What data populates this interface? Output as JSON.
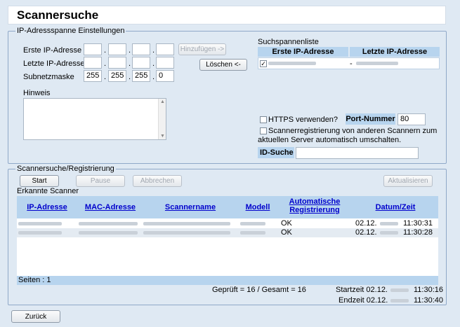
{
  "title": "Scannersuche",
  "ip_group": {
    "legend": "IP-Adressspanne Einstellungen",
    "first_ip_label": "Erste IP-Adresse",
    "last_ip_label": "Letzte IP-Adresse",
    "subnet_label": "Subnetzmaske",
    "subnet": [
      "255",
      "255",
      "255",
      "0"
    ],
    "add_button": "Hinzufügen ->",
    "delete_button": "Löschen <-",
    "note_label": "Hinweis",
    "range_list_title": "Suchspannenliste",
    "range_list_headers": [
      "Erste IP-Adresse",
      "Letzte IP-Adresse"
    ],
    "range_separator": "-",
    "https_label": "HTTPS verwenden?",
    "port_label": "Port-Nummer",
    "port_value": "80",
    "switch_label_1": "Scannerregistrierung von anderen Scannern zum",
    "switch_label_2": "aktuellen Server automatisch umschalten.",
    "id_search_label": "ID-Suche"
  },
  "search_group": {
    "legend": "Scannersuche/Registrierung",
    "start_button": "Start",
    "pause_button": "Pause",
    "cancel_button": "Abbrechen",
    "refresh_button": "Aktualisieren",
    "detected_label": "Erkannte Scanner",
    "columns": [
      "IP-Adresse",
      "MAC-Adresse",
      "Scannername",
      "Modell",
      "Automatische",
      "Registrierung",
      "Datum/Zeit"
    ],
    "rows": [
      {
        "status": "OK",
        "date": "02.12.",
        "time": "11:30:31"
      },
      {
        "status": "OK",
        "date": "02.12.",
        "time": "11:30:28"
      }
    ],
    "pages_label": "Seiten :  1",
    "summary": "Geprüft = 16 / Gesamt = 16",
    "start_time_label": "Startzeit 02.12.",
    "start_time": "11:30:16",
    "end_time_label": "Endzeit 02.12.",
    "end_time": "11:30:40"
  },
  "back_button": "Zurück",
  "colors": {
    "background": "#dfe9f3",
    "header": "#b7d4ee",
    "link": "#0000cc"
  }
}
